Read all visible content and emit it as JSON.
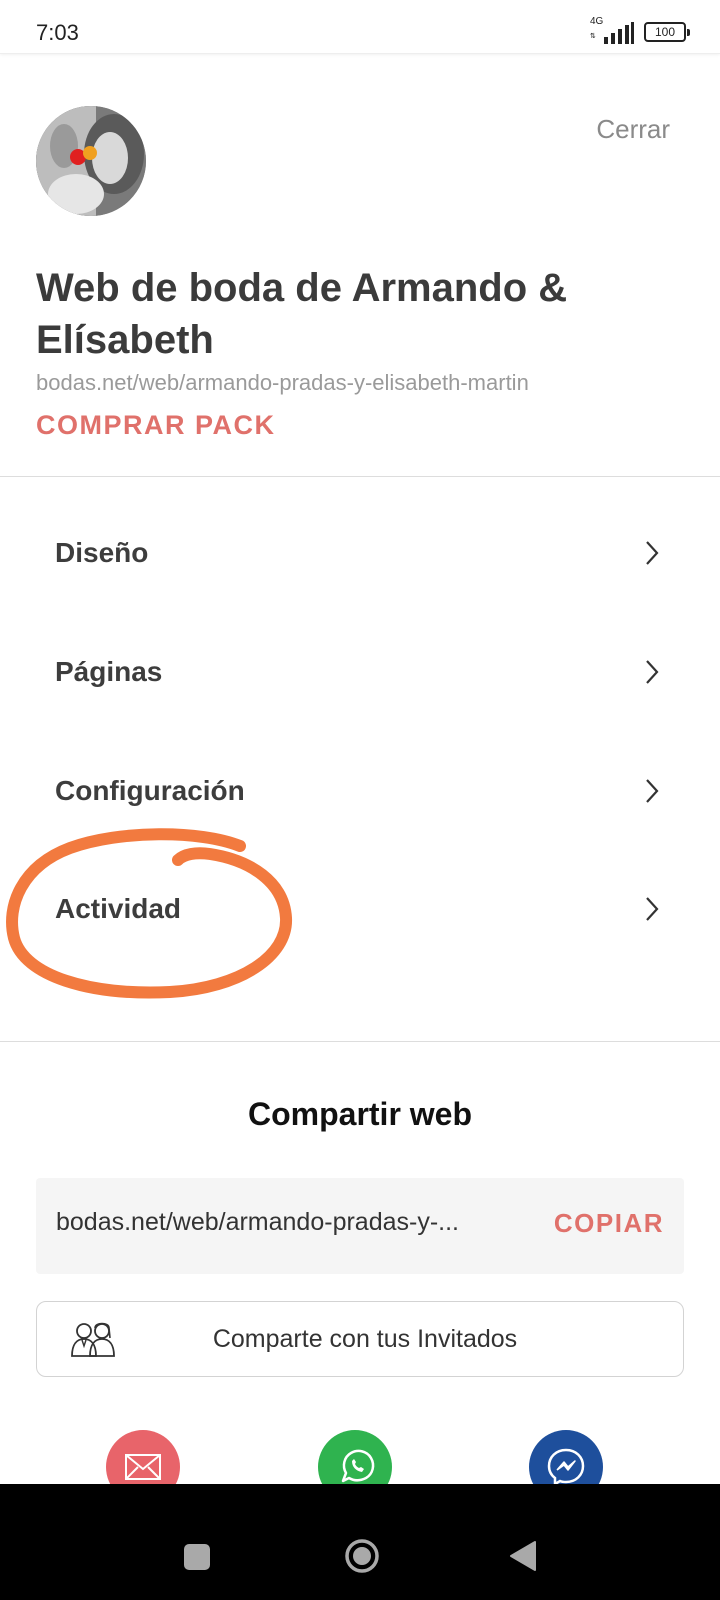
{
  "status_bar": {
    "time": "7:03",
    "network": "4G",
    "battery": "100"
  },
  "header": {
    "close_label": "Cerrar",
    "title": "Web de boda de Armando & Elísabeth",
    "url": "bodas.net/web/armando-pradas-y-elisabeth-martin",
    "buy_pack_label": "COMPRAR PACK"
  },
  "menu": {
    "items": [
      {
        "label": "Diseño"
      },
      {
        "label": "Páginas"
      },
      {
        "label": "Configuración"
      },
      {
        "label": "Actividad"
      }
    ]
  },
  "share": {
    "title": "Compartir web",
    "url_text": "bodas.net/web/armando-pradas-y-...",
    "copy_label": "COPIAR",
    "guests_label": "Comparte con tus Invitados",
    "channels": [
      "email-icon",
      "whatsapp-icon",
      "messenger-icon"
    ]
  },
  "colors": {
    "accent": "#e0716b",
    "annotation": "#f27a3f",
    "email": "#e8646a",
    "whatsapp": "#2fb34f",
    "messenger": "#1e4f9c"
  }
}
